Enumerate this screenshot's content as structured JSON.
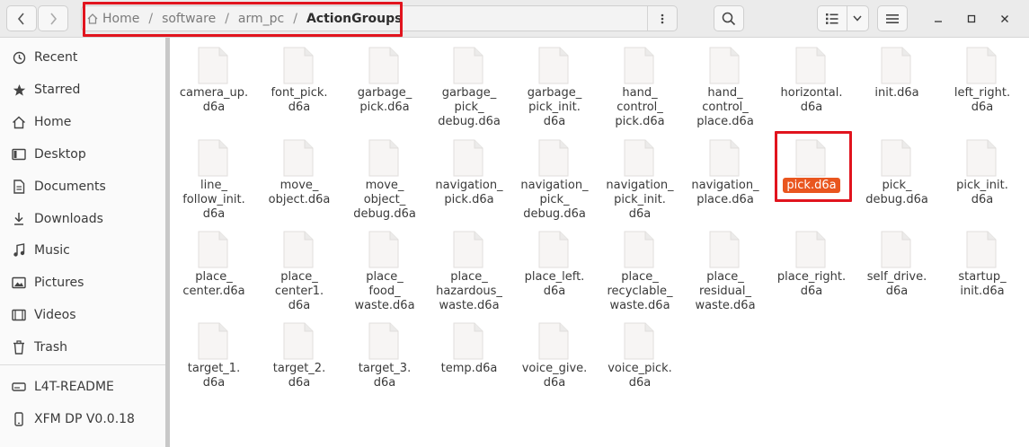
{
  "header": {
    "path": {
      "segments": [
        "Home",
        "software",
        "arm_pc",
        "ActionGroups"
      ],
      "separator": "/"
    }
  },
  "sidebar": {
    "items": [
      {
        "label": "Recent",
        "icon": "clock-icon"
      },
      {
        "label": "Starred",
        "icon": "star-icon"
      },
      {
        "label": "Home",
        "icon": "home-icon"
      },
      {
        "label": "Desktop",
        "icon": "desktop-icon"
      },
      {
        "label": "Documents",
        "icon": "document-icon"
      },
      {
        "label": "Downloads",
        "icon": "download-icon"
      },
      {
        "label": "Music",
        "icon": "music-icon"
      },
      {
        "label": "Pictures",
        "icon": "picture-icon"
      },
      {
        "label": "Videos",
        "icon": "video-icon"
      },
      {
        "label": "Trash",
        "icon": "trash-icon"
      }
    ],
    "devices": [
      {
        "label": "L4T-README",
        "icon": "drive-icon"
      },
      {
        "label": "XFM DP V0.0.18",
        "icon": "phone-icon"
      }
    ]
  },
  "files": [
    "camera_up.\nd6a",
    "font_pick.\nd6a",
    "garbage_\npick.d6a",
    "garbage_\npick_\ndebug.d6a",
    "garbage_\npick_init.\nd6a",
    "hand_\ncontrol_\npick.d6a",
    "hand_\ncontrol_\nplace.d6a",
    "horizontal.\nd6a",
    "init.d6a",
    "left_right.\nd6a",
    "line_\nfollow_init.\nd6a",
    "move_\nobject.d6a",
    "move_\nobject_\ndebug.d6a",
    "navigation_\npick.d6a",
    "navigation_\npick_\ndebug.d6a",
    "navigation_\npick_init.\nd6a",
    "navigation_\nplace.d6a",
    "pick.d6a",
    "pick_\ndebug.d6a",
    "pick_init.\nd6a",
    "place_\ncenter.d6a",
    "place_\ncenter1.\nd6a",
    "place_\nfood_\nwaste.d6a",
    "place_\nhazardous_\nwaste.d6a",
    "place_left.\nd6a",
    "place_\nrecyclable_\nwaste.d6a",
    "place_\nresidual_\nwaste.d6a",
    "place_right.\nd6a",
    "self_drive.\nd6a",
    "startup_\ninit.d6a",
    "target_1.\nd6a",
    "target_2.\nd6a",
    "target_3.\nd6a",
    "temp.d6a",
    "voice_give.\nd6a",
    "voice_pick.\nd6a"
  ],
  "selected_file": "pick.d6a",
  "colors": {
    "selection": "#e9561f",
    "highlight_box": "#e1141e"
  }
}
